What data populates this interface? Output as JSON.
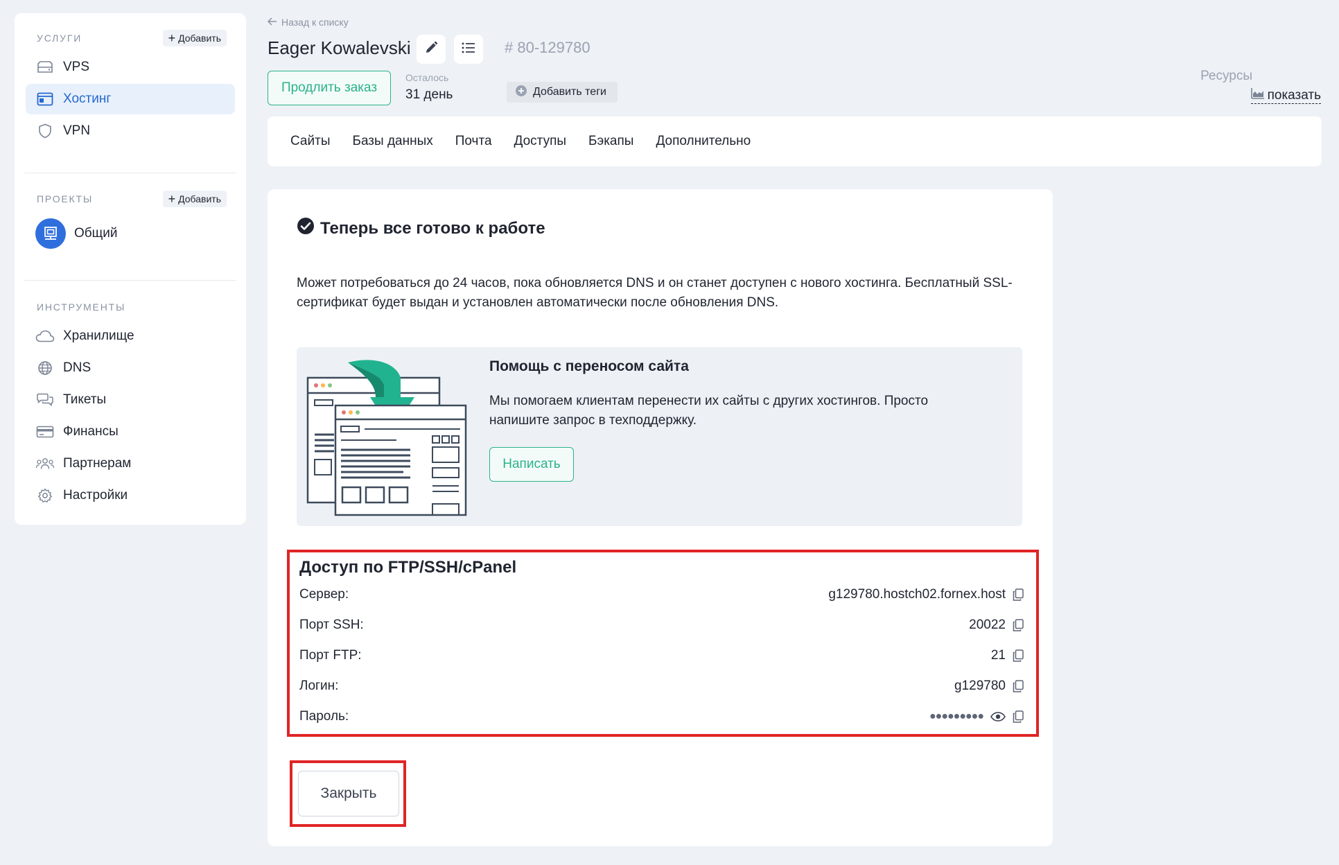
{
  "sidebar": {
    "services": {
      "heading": "Услуги",
      "add_label": "Добавить",
      "items": [
        {
          "label": "VPS",
          "icon": "server-icon"
        },
        {
          "label": "Хостинг",
          "icon": "browser-window-icon",
          "active": true
        },
        {
          "label": "VPN",
          "icon": "shield-icon"
        }
      ]
    },
    "projects": {
      "heading": "Проекты",
      "add_label": "Добавить",
      "items": [
        {
          "label": "Общий",
          "icon": "project-icon"
        }
      ]
    },
    "tools": {
      "heading": "Инструменты",
      "items": [
        {
          "label": "Хранилище",
          "icon": "cloud-icon"
        },
        {
          "label": "DNS",
          "icon": "globe-icon"
        },
        {
          "label": "Тикеты",
          "icon": "chat-icon"
        },
        {
          "label": "Финансы",
          "icon": "credit-card-icon"
        },
        {
          "label": "Партнерам",
          "icon": "users-icon"
        },
        {
          "label": "Настройки",
          "icon": "gear-icon"
        }
      ]
    }
  },
  "header": {
    "back_label": "Назад к списку",
    "title": "Eager Kowalevski",
    "order_id": "# 80-129780",
    "renew_label": "Продлить заказ",
    "remain_label": "Осталось",
    "remain_value": "31 день",
    "tags_label": "Добавить теги",
    "resources_label": "Ресурсы",
    "resources_link": "показать"
  },
  "tabs": [
    "Сайты",
    "Базы данных",
    "Почта",
    "Доступы",
    "Бэкапы",
    "Дополнительно"
  ],
  "card": {
    "title": "Теперь все готово к работе",
    "text": "Может потребоваться до 24 часов, пока обновляется DNS и он станет доступен с нового хостинга. Бесплатный SSL-сертификат будет выдан и установлен автоматически после обновления DNS.",
    "help": {
      "title": "Помощь с переносом сайта",
      "text": "Мы помогаем клиентам перенести их сайты с других хостингов. Просто напишите запрос в техподдержку.",
      "button": "Написать"
    },
    "access": {
      "title": "Доступ по FTP/SSH/cPanel",
      "rows": [
        {
          "label": "Сервер:",
          "value": "g129780.hostch02.fornex.host"
        },
        {
          "label": "Порт SSH:",
          "value": "20022"
        },
        {
          "label": "Порт FTP:",
          "value": "21"
        },
        {
          "label": "Логин:",
          "value": "g129780"
        },
        {
          "label": "Пароль:",
          "value": "●●●●●●●●●"
        }
      ]
    },
    "close_label": "Закрыть"
  },
  "colors": {
    "accent_green": "#2bb28a",
    "accent_blue": "#2468cf",
    "highlight_red": "#e02424",
    "background": "#eef1f5"
  }
}
